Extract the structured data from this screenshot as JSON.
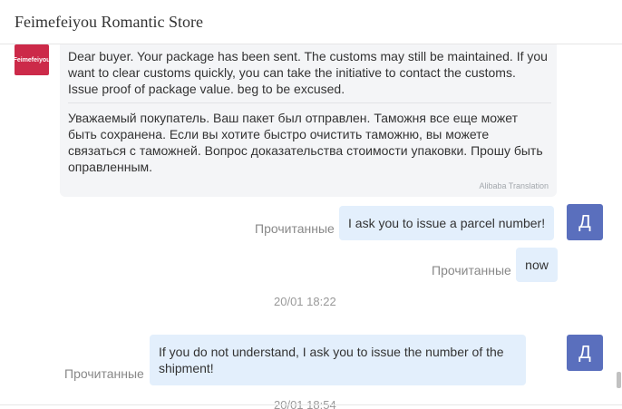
{
  "header": {
    "title": "Feimefeiyou Romantic Store"
  },
  "store_avatar": {
    "text": "Feimefeiyou",
    "color": "#cc2a49"
  },
  "messages": {
    "incoming": {
      "text_en": "Dear buyer. Your package has been sent. The customs may still be maintained. If you want to clear customs quickly, you can take the initiative to contact the customs. Issue proof of package value. beg to be excused.",
      "text_ru": "Уважаемый покупатель. Ваш пакет был отправлен. Таможня все еще может быть сохранена. Если вы хотите быстро очистить таможню, вы можете связаться с таможней. Вопрос доказательства стоимости упаковки. Прошу быть оправленным.",
      "translation_label": "Alibaba Translation"
    },
    "out1": {
      "text": "I ask you to issue a parcel number!",
      "status": "Прочитанные"
    },
    "out2": {
      "text": "now",
      "status": "Прочитанные"
    },
    "time1": "20/01 18:22",
    "out3": {
      "text": "If you do not understand, I ask you to issue the number of the shipment!",
      "status": "Прочитанные"
    },
    "time2": "20/01 18:54"
  },
  "user_avatar": {
    "letter": "Д",
    "color": "#5a6fbd"
  },
  "colors": {
    "bubble_out": "#e3effc",
    "bubble_in": "#f4f5f7"
  }
}
